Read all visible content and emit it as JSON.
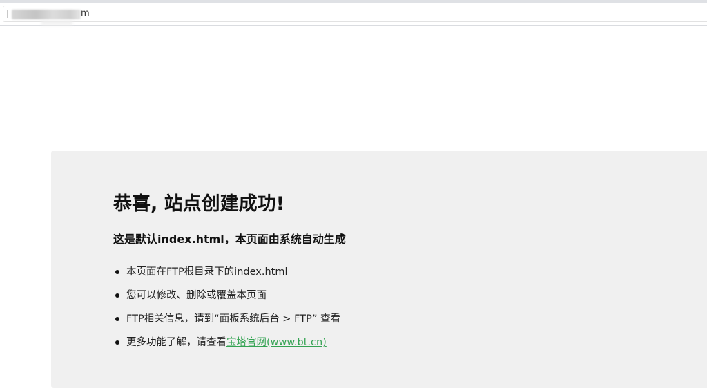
{
  "browser": {
    "url_visible_suffix": "m"
  },
  "page": {
    "title": "恭喜, 站点创建成功!",
    "subtitle": "这是默认index.html，本页面由系统自动生成",
    "items": [
      {
        "text": "本页面在FTP根目录下的index.html"
      },
      {
        "text": "您可以修改、删除或覆盖本页面"
      },
      {
        "text": "FTP相关信息，请到“面板系统后台 > FTP” 查看"
      },
      {
        "text": "更多功能了解，请查看",
        "link_text": "宝塔官网(www.bt.cn)"
      }
    ]
  },
  "colors": {
    "panel_background": "#f0f0f0",
    "link": "#35a353",
    "text": "#111111"
  },
  "icons": {
    "list_bullet": "bullet-dot-icon"
  }
}
